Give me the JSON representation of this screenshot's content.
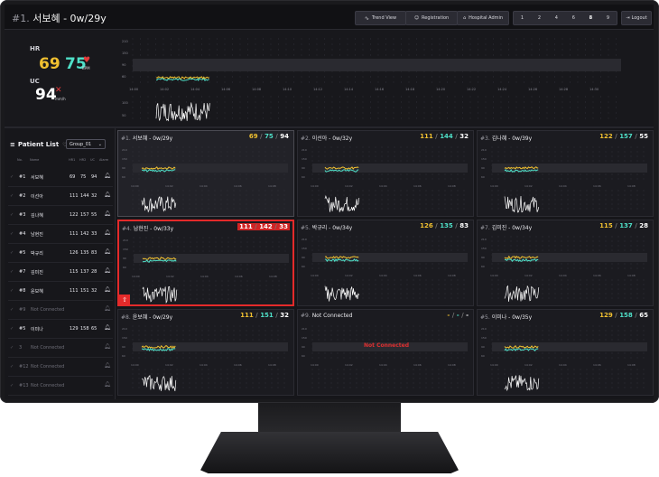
{
  "header": {
    "title_no": "#1.",
    "title": "서보혜 - 0w/29y",
    "buttons": {
      "trend": "Trend View",
      "registration": "Registration",
      "hospital": "Hospital Admin",
      "logout": "Logout"
    },
    "grid_options": [
      "1",
      "2",
      "4",
      "6",
      "8",
      "9"
    ],
    "grid_selected": "8"
  },
  "detail": {
    "hr_label": "HR",
    "hr_value_1": "69",
    "hr_value_2": "75",
    "bpm_unit": "BPM",
    "uc_label": "UC",
    "uc_value": "94",
    "uc_unit": "mm/h",
    "time_ticks": [
      "14:00",
      "14:02",
      "14:04",
      "14:06",
      "14:08",
      "14:10",
      "14:12",
      "14:14",
      "14:16",
      "14:18",
      "14:20",
      "14:22",
      "14:24",
      "14:26",
      "14:28",
      "14:30"
    ],
    "hr_ticks": [
      "210",
      "150",
      "90",
      "60"
    ],
    "uc_ticks": [
      "100",
      "50"
    ]
  },
  "sidebar": {
    "title": "Patient List",
    "group": "Group_01",
    "columns": {
      "no": "No.",
      "name": "Name",
      "hr1": "HR1",
      "hr2": "HR2",
      "uc": "UC",
      "alarm": "Alarm"
    },
    "patients": [
      {
        "no": "#1",
        "name": "서보혜",
        "hr1": "69",
        "hr2": "75",
        "uc": "94",
        "nc": false
      },
      {
        "no": "#2",
        "name": "이선아",
        "hr1": "111",
        "hr2": "144",
        "uc": "32",
        "nc": false
      },
      {
        "no": "#3",
        "name": "김나혜",
        "hr1": "122",
        "hr2": "157",
        "uc": "55",
        "nc": false
      },
      {
        "no": "#4",
        "name": "남현진",
        "hr1": "111",
        "hr2": "142",
        "uc": "33",
        "nc": false
      },
      {
        "no": "#5",
        "name": "박규리",
        "hr1": "126",
        "hr2": "135",
        "uc": "83",
        "nc": false
      },
      {
        "no": "#7",
        "name": "김미진",
        "hr1": "115",
        "hr2": "137",
        "uc": "28",
        "nc": false
      },
      {
        "no": "#8",
        "name": "윤보혜",
        "hr1": "111",
        "hr2": "151",
        "uc": "32",
        "nc": false
      },
      {
        "no": "#9",
        "name": "Not Connected",
        "hr1": "",
        "hr2": "",
        "uc": "",
        "nc": true
      },
      {
        "no": "#5",
        "name": "이미나",
        "hr1": "129",
        "hr2": "158",
        "uc": "65",
        "nc": false
      },
      {
        "no": "3",
        "name": "Not Connected",
        "hr1": "",
        "hr2": "",
        "uc": "",
        "nc": true
      },
      {
        "no": "#12",
        "name": "Not Connected",
        "hr1": "",
        "hr2": "",
        "uc": "",
        "nc": true
      },
      {
        "no": "#13",
        "name": "Not Connected",
        "hr1": "",
        "hr2": "",
        "uc": "",
        "nc": true
      }
    ]
  },
  "tiles": [
    {
      "no": "#1.",
      "name": "서보혜 - 0w/29y",
      "v1": "69",
      "v2": "75",
      "v3": "94",
      "state": "selected"
    },
    {
      "no": "#2.",
      "name": "이선아 - 0w/32y",
      "v1": "111",
      "v2": "144",
      "v3": "32",
      "state": "normal"
    },
    {
      "no": "#3.",
      "name": "김나혜 - 0w/39y",
      "v1": "122",
      "v2": "157",
      "v3": "55",
      "state": "normal"
    },
    {
      "no": "#4.",
      "name": "남현진 - 0w/33y",
      "v1": "111",
      "v2": "142",
      "v3": "33",
      "state": "alarm"
    },
    {
      "no": "#5.",
      "name": "박규리 - 0w/34y",
      "v1": "126",
      "v2": "135",
      "v3": "83",
      "state": "normal"
    },
    {
      "no": "#7.",
      "name": "김미진 - 0w/34y",
      "v1": "115",
      "v2": "137",
      "v3": "28",
      "state": "normal"
    },
    {
      "no": "#8.",
      "name": "윤보혜 - 0w/29y",
      "v1": "111",
      "v2": "151",
      "v3": "32",
      "state": "normal"
    },
    {
      "no": "#9.",
      "name": "Not Connected",
      "v1": "-",
      "v2": "-",
      "v3": "-",
      "state": "nc",
      "nc_text": "Not Connected"
    },
    {
      "no": "#5.",
      "name": "이미나 - 0w/35y",
      "v1": "129",
      "v2": "158",
      "v3": "65",
      "state": "normal"
    }
  ],
  "tile_ticks": {
    "hr": [
      "210",
      "150",
      "90",
      "60"
    ],
    "time": [
      "14:00",
      "14:02",
      "14:04",
      "14:06",
      "14:08"
    ]
  },
  "colors": {
    "hr1": "#f0c030",
    "hr2": "#4fe0c8",
    "uc": "#ffffff",
    "alarm": "#e42a2a",
    "panel": "#1b1b20"
  }
}
